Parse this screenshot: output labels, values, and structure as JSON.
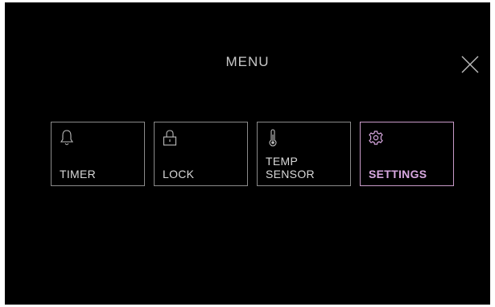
{
  "menu": {
    "title": "MENU",
    "close_icon": "close-icon",
    "items": [
      {
        "label": "TIMER",
        "icon": "bell-icon",
        "selected": false
      },
      {
        "label": "LOCK",
        "icon": "lock-icon",
        "selected": false
      },
      {
        "label": "TEMP\nSENSOR",
        "icon": "thermometer-icon",
        "selected": false
      },
      {
        "label": "SETTINGS",
        "icon": "gear-icon",
        "selected": true
      }
    ]
  },
  "colors": {
    "background": "#000000",
    "text": "#d8d8d8",
    "border": "#8a8a8a",
    "accent": "#d8a8e0"
  }
}
